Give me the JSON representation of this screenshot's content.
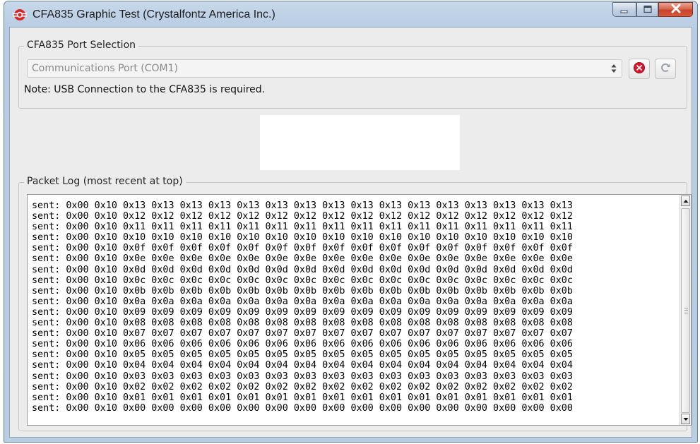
{
  "window": {
    "title": "CFA835 Graphic Test (Crystalfontz America Inc.)"
  },
  "port_selection": {
    "group_label": "CFA835 Port Selection",
    "selected_port": "Communications Port (COM1)",
    "note": "Note: USB Connection to the CFA835 is required.",
    "disconnect_icon": "red-x-circle-icon",
    "refresh_icon": "refresh-icon"
  },
  "packet_log": {
    "group_label": "Packet Log (most recent at top)",
    "lines": [
      "sent: 0x00 0x10 0x13 0x13 0x13 0x13 0x13 0x13 0x13 0x13 0x13 0x13 0x13 0x13 0x13 0x13 0x13 0x13",
      "sent: 0x00 0x10 0x12 0x12 0x12 0x12 0x12 0x12 0x12 0x12 0x12 0x12 0x12 0x12 0x12 0x12 0x12 0x12",
      "sent: 0x00 0x10 0x11 0x11 0x11 0x11 0x11 0x11 0x11 0x11 0x11 0x11 0x11 0x11 0x11 0x11 0x11 0x11",
      "sent: 0x00 0x10 0x10 0x10 0x10 0x10 0x10 0x10 0x10 0x10 0x10 0x10 0x10 0x10 0x10 0x10 0x10 0x10",
      "sent: 0x00 0x10 0x0f 0x0f 0x0f 0x0f 0x0f 0x0f 0x0f 0x0f 0x0f 0x0f 0x0f 0x0f 0x0f 0x0f 0x0f 0x0f",
      "sent: 0x00 0x10 0x0e 0x0e 0x0e 0x0e 0x0e 0x0e 0x0e 0x0e 0x0e 0x0e 0x0e 0x0e 0x0e 0x0e 0x0e 0x0e",
      "sent: 0x00 0x10 0x0d 0x0d 0x0d 0x0d 0x0d 0x0d 0x0d 0x0d 0x0d 0x0d 0x0d 0x0d 0x0d 0x0d 0x0d 0x0d",
      "sent: 0x00 0x10 0x0c 0x0c 0x0c 0x0c 0x0c 0x0c 0x0c 0x0c 0x0c 0x0c 0x0c 0x0c 0x0c 0x0c 0x0c 0x0c",
      "sent: 0x00 0x10 0x0b 0x0b 0x0b 0x0b 0x0b 0x0b 0x0b 0x0b 0x0b 0x0b 0x0b 0x0b 0x0b 0x0b 0x0b 0x0b",
      "sent: 0x00 0x10 0x0a 0x0a 0x0a 0x0a 0x0a 0x0a 0x0a 0x0a 0x0a 0x0a 0x0a 0x0a 0x0a 0x0a 0x0a 0x0a",
      "sent: 0x00 0x10 0x09 0x09 0x09 0x09 0x09 0x09 0x09 0x09 0x09 0x09 0x09 0x09 0x09 0x09 0x09 0x09",
      "sent: 0x00 0x10 0x08 0x08 0x08 0x08 0x08 0x08 0x08 0x08 0x08 0x08 0x08 0x08 0x08 0x08 0x08 0x08",
      "sent: 0x00 0x10 0x07 0x07 0x07 0x07 0x07 0x07 0x07 0x07 0x07 0x07 0x07 0x07 0x07 0x07 0x07 0x07",
      "sent: 0x00 0x10 0x06 0x06 0x06 0x06 0x06 0x06 0x06 0x06 0x06 0x06 0x06 0x06 0x06 0x06 0x06 0x06",
      "sent: 0x00 0x10 0x05 0x05 0x05 0x05 0x05 0x05 0x05 0x05 0x05 0x05 0x05 0x05 0x05 0x05 0x05 0x05",
      "sent: 0x00 0x10 0x04 0x04 0x04 0x04 0x04 0x04 0x04 0x04 0x04 0x04 0x04 0x04 0x04 0x04 0x04 0x04",
      "sent: 0x00 0x10 0x03 0x03 0x03 0x03 0x03 0x03 0x03 0x03 0x03 0x03 0x03 0x03 0x03 0x03 0x03 0x03",
      "sent: 0x00 0x10 0x02 0x02 0x02 0x02 0x02 0x02 0x02 0x02 0x02 0x02 0x02 0x02 0x02 0x02 0x02 0x02",
      "sent: 0x00 0x10 0x01 0x01 0x01 0x01 0x01 0x01 0x01 0x01 0x01 0x01 0x01 0x01 0x01 0x01 0x01 0x01",
      "sent: 0x00 0x10 0x00 0x00 0x00 0x00 0x00 0x00 0x00 0x00 0x00 0x00 0x00 0x00 0x00 0x00 0x00 0x00"
    ]
  },
  "colors": {
    "close_button": "#c7442b",
    "disconnect_red": "#d9142b",
    "app_icon_red": "#d8262a"
  }
}
